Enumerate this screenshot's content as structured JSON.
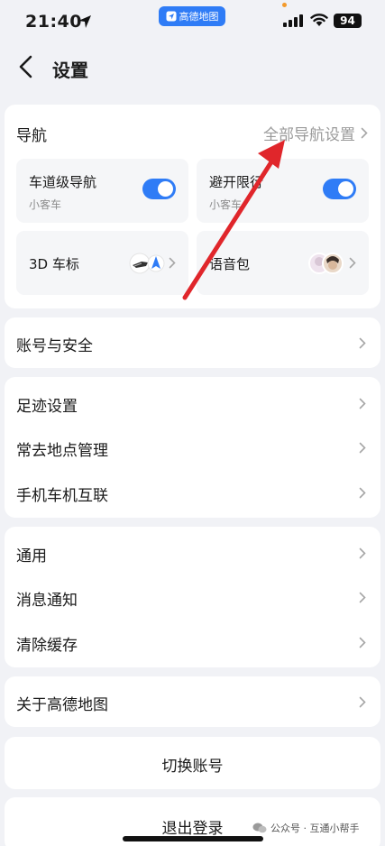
{
  "status_bar": {
    "time": "21:40",
    "app_name": "高德地图",
    "battery": "94"
  },
  "header": {
    "title": "设置"
  },
  "nav_section": {
    "title": "导航",
    "all_settings": "全部导航设置",
    "tiles": [
      {
        "title": "车道级导航",
        "subtitle": "小客车",
        "toggle": true
      },
      {
        "title": "避开限行",
        "subtitle": "小客车",
        "toggle": true
      },
      {
        "title": "3D 车标"
      },
      {
        "title": "语音包"
      }
    ]
  },
  "account_section": {
    "items": [
      {
        "label": "账号与安全"
      }
    ]
  },
  "places_section": {
    "items": [
      {
        "label": "足迹设置"
      },
      {
        "label": "常去地点管理"
      },
      {
        "label": "手机车机互联"
      }
    ]
  },
  "general_section": {
    "items": [
      {
        "label": "通用"
      },
      {
        "label": "消息通知"
      },
      {
        "label": "清除缓存"
      }
    ]
  },
  "about_section": {
    "items": [
      {
        "label": "关于高德地图"
      }
    ]
  },
  "switch_account": {
    "label": "切换账号"
  },
  "logout": {
    "label": "退出登录"
  },
  "watermark": {
    "text": "公众号 · 互通小帮手"
  },
  "colors": {
    "accent": "#2f7cf6",
    "annotation_arrow": "#e0262b",
    "background": "#f1f2f6"
  }
}
